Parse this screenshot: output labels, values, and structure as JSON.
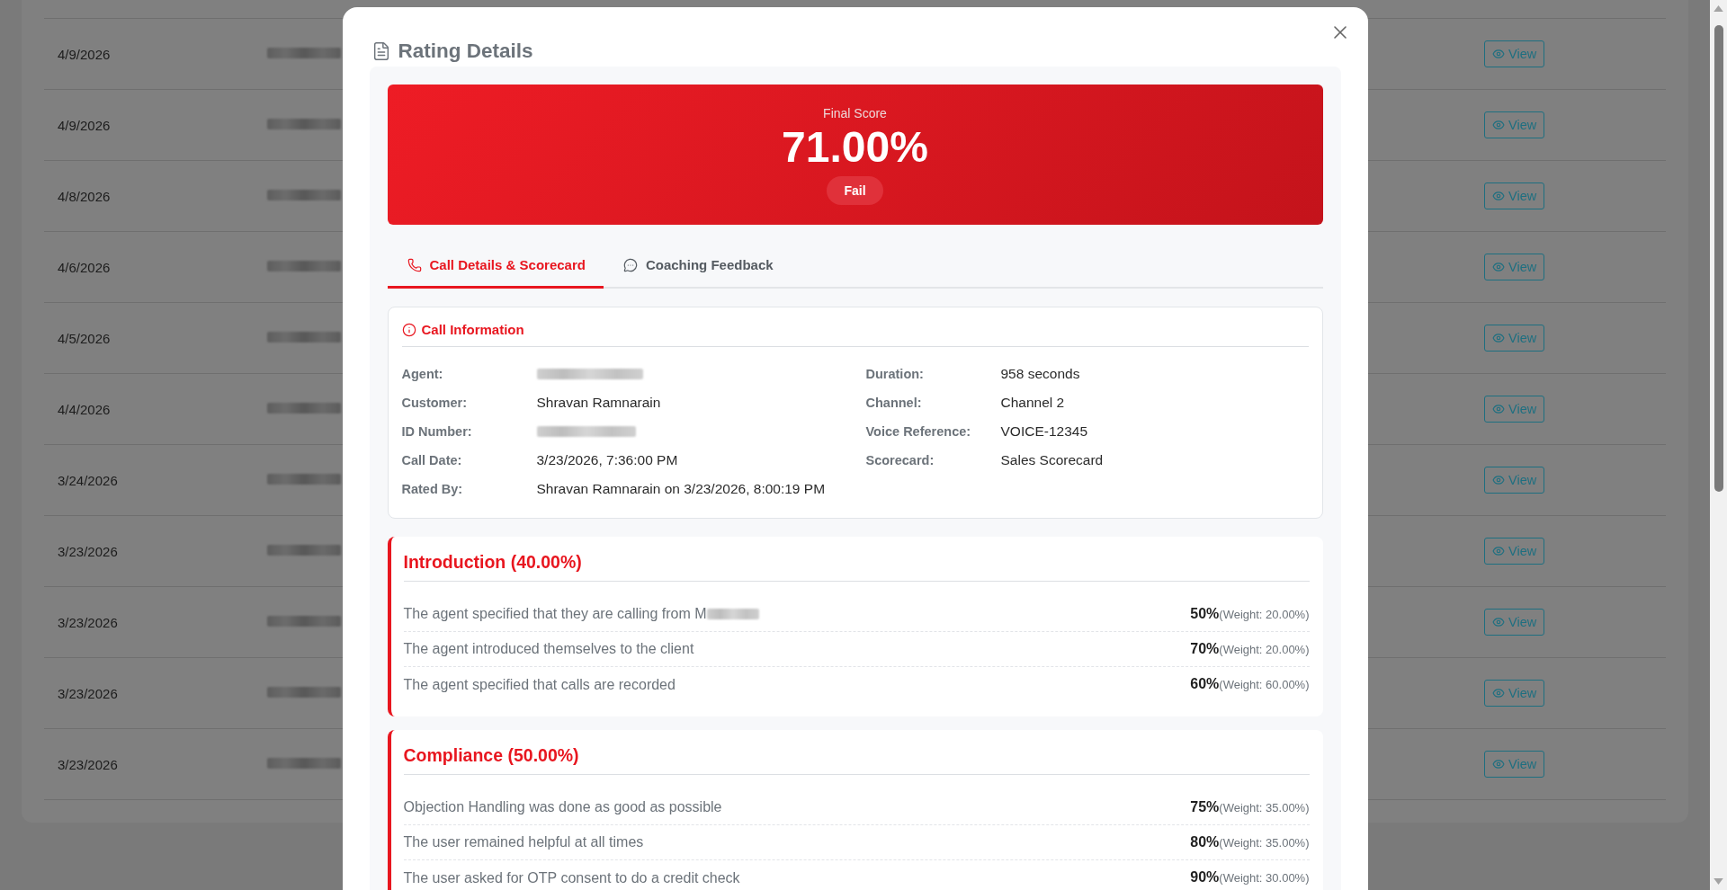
{
  "records_table": {
    "rows": [
      {
        "date": "4/9/2026",
        "agent_redacted": true,
        "action": "View"
      },
      {
        "date": "4/9/2026",
        "agent_redacted": true,
        "action": "View"
      },
      {
        "date": "4/8/2026",
        "agent_redacted": true,
        "action": "View"
      },
      {
        "date": "4/6/2026",
        "agent_redacted": true,
        "action": "View"
      },
      {
        "date": "4/5/2026",
        "agent_redacted": true,
        "action": "View"
      },
      {
        "date": "4/4/2026",
        "agent_redacted": true,
        "action": "View"
      },
      {
        "date": "3/24/2026",
        "agent_redacted": true,
        "action": "View"
      },
      {
        "date": "3/23/2026",
        "agent_redacted": true,
        "action": "View"
      },
      {
        "date": "3/23/2026",
        "agent_redacted": true,
        "action": "View"
      },
      {
        "date": "3/23/2026",
        "agent_redacted": true,
        "action": "View"
      },
      {
        "date": "3/23/2026",
        "agent_redacted": true,
        "action": "View"
      }
    ]
  },
  "modal": {
    "title": "Rating Details",
    "final_score": {
      "label": "Final Score",
      "value": "71.00%",
      "result": "Fail",
      "passed": false
    },
    "tabs": [
      {
        "label": "Call Details & Scorecard",
        "selected": true
      },
      {
        "label": "Coaching Feedback",
        "selected": false
      }
    ],
    "call_information": {
      "title": "Call Information",
      "fields_left": [
        {
          "label": "Agent:",
          "redacted": true
        },
        {
          "label": "Customer:",
          "value": "Shravan Ramnarain",
          "redacted": false
        },
        {
          "label": "ID Number:",
          "redacted": true
        },
        {
          "label": "Call Date:",
          "value": "3/23/2026, 7:36:00 PM",
          "redacted": false
        },
        {
          "label": "Rated By:",
          "value": "Shravan Ramnarain on 3/23/2026, 8:00:19 PM",
          "redacted": false
        }
      ],
      "fields_right": [
        {
          "label": "Duration:",
          "value": "958 seconds",
          "redacted": false
        },
        {
          "label": "Channel:",
          "value": "Channel 2",
          "redacted": false
        },
        {
          "label": "Voice Reference:",
          "value": "VOICE-12345",
          "redacted": false
        },
        {
          "label": "Scorecard:",
          "value": "Sales Scorecard",
          "redacted": false
        }
      ]
    },
    "sections": [
      {
        "title": "Introduction (40.00%)",
        "items": [
          {
            "text": "The agent specified that they are calling from M",
            "redacted_tail": true,
            "score": "50%",
            "weight": "(Weight: 20.00%)"
          },
          {
            "text": "The agent introduced themselves to the client",
            "redacted_tail": false,
            "score": "70%",
            "weight": "(Weight: 20.00%)"
          },
          {
            "text": "The agent specified that calls are recorded",
            "redacted_tail": false,
            "score": "60%",
            "weight": "(Weight: 60.00%)"
          }
        ]
      },
      {
        "title": "Compliance (50.00%)",
        "items": [
          {
            "text": "Objection Handling was done as good as possible",
            "redacted_tail": false,
            "score": "75%",
            "weight": "(Weight: 35.00%)"
          },
          {
            "text": "The user remained helpful at all times",
            "redacted_tail": false,
            "score": "80%",
            "weight": "(Weight: 35.00%)"
          },
          {
            "text": "The user asked for OTP consent to do a credit check",
            "redacted_tail": false,
            "score": "90%",
            "weight": "(Weight: 30.00%)"
          }
        ]
      }
    ]
  }
}
